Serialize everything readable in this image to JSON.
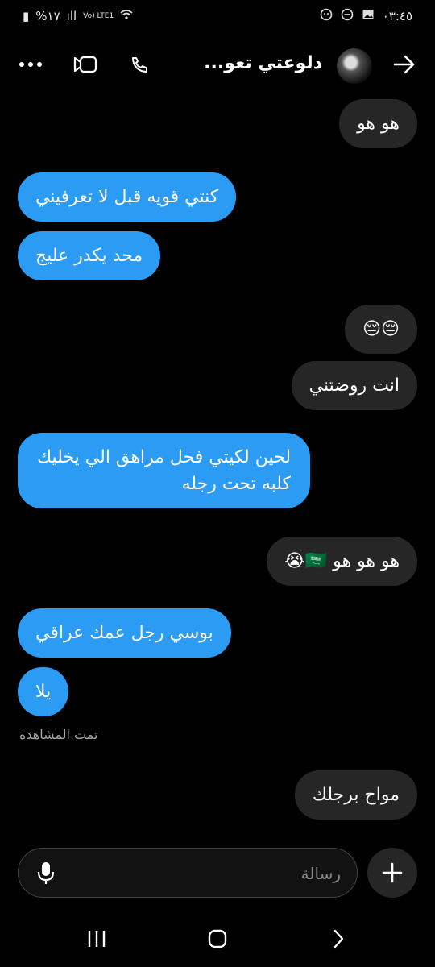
{
  "status": {
    "time": "٠٣:٤٥",
    "battery": "%١٧",
    "network": "Vo) LTE1"
  },
  "header": {
    "title": "دلوعتي تعو..."
  },
  "messages": [
    {
      "from": "them",
      "text": "هو هو"
    },
    {
      "from": "me",
      "text": "كنتي قويه قبل لا تعرفيني"
    },
    {
      "from": "me",
      "text": "محد يكدر عليج"
    },
    {
      "from": "them",
      "text": "😔😔"
    },
    {
      "from": "them",
      "text": "انت روضتني"
    },
    {
      "from": "me",
      "text": "لحين لكيتي فحل مراهق الي يخليك"
    },
    {
      "from": "me",
      "text": "كلبه تحت رجله"
    },
    {
      "from": "them",
      "text": "هو هو هو 🇸🇦😭"
    },
    {
      "from": "me",
      "text": "بوسي رجل عمك عراقي"
    },
    {
      "from": "me",
      "text": "يلا"
    },
    {
      "from": "them",
      "text": "مواح برجلك"
    }
  ],
  "seen_label": "تمت المشاهدة",
  "composer": {
    "placeholder": "رسالة"
  }
}
